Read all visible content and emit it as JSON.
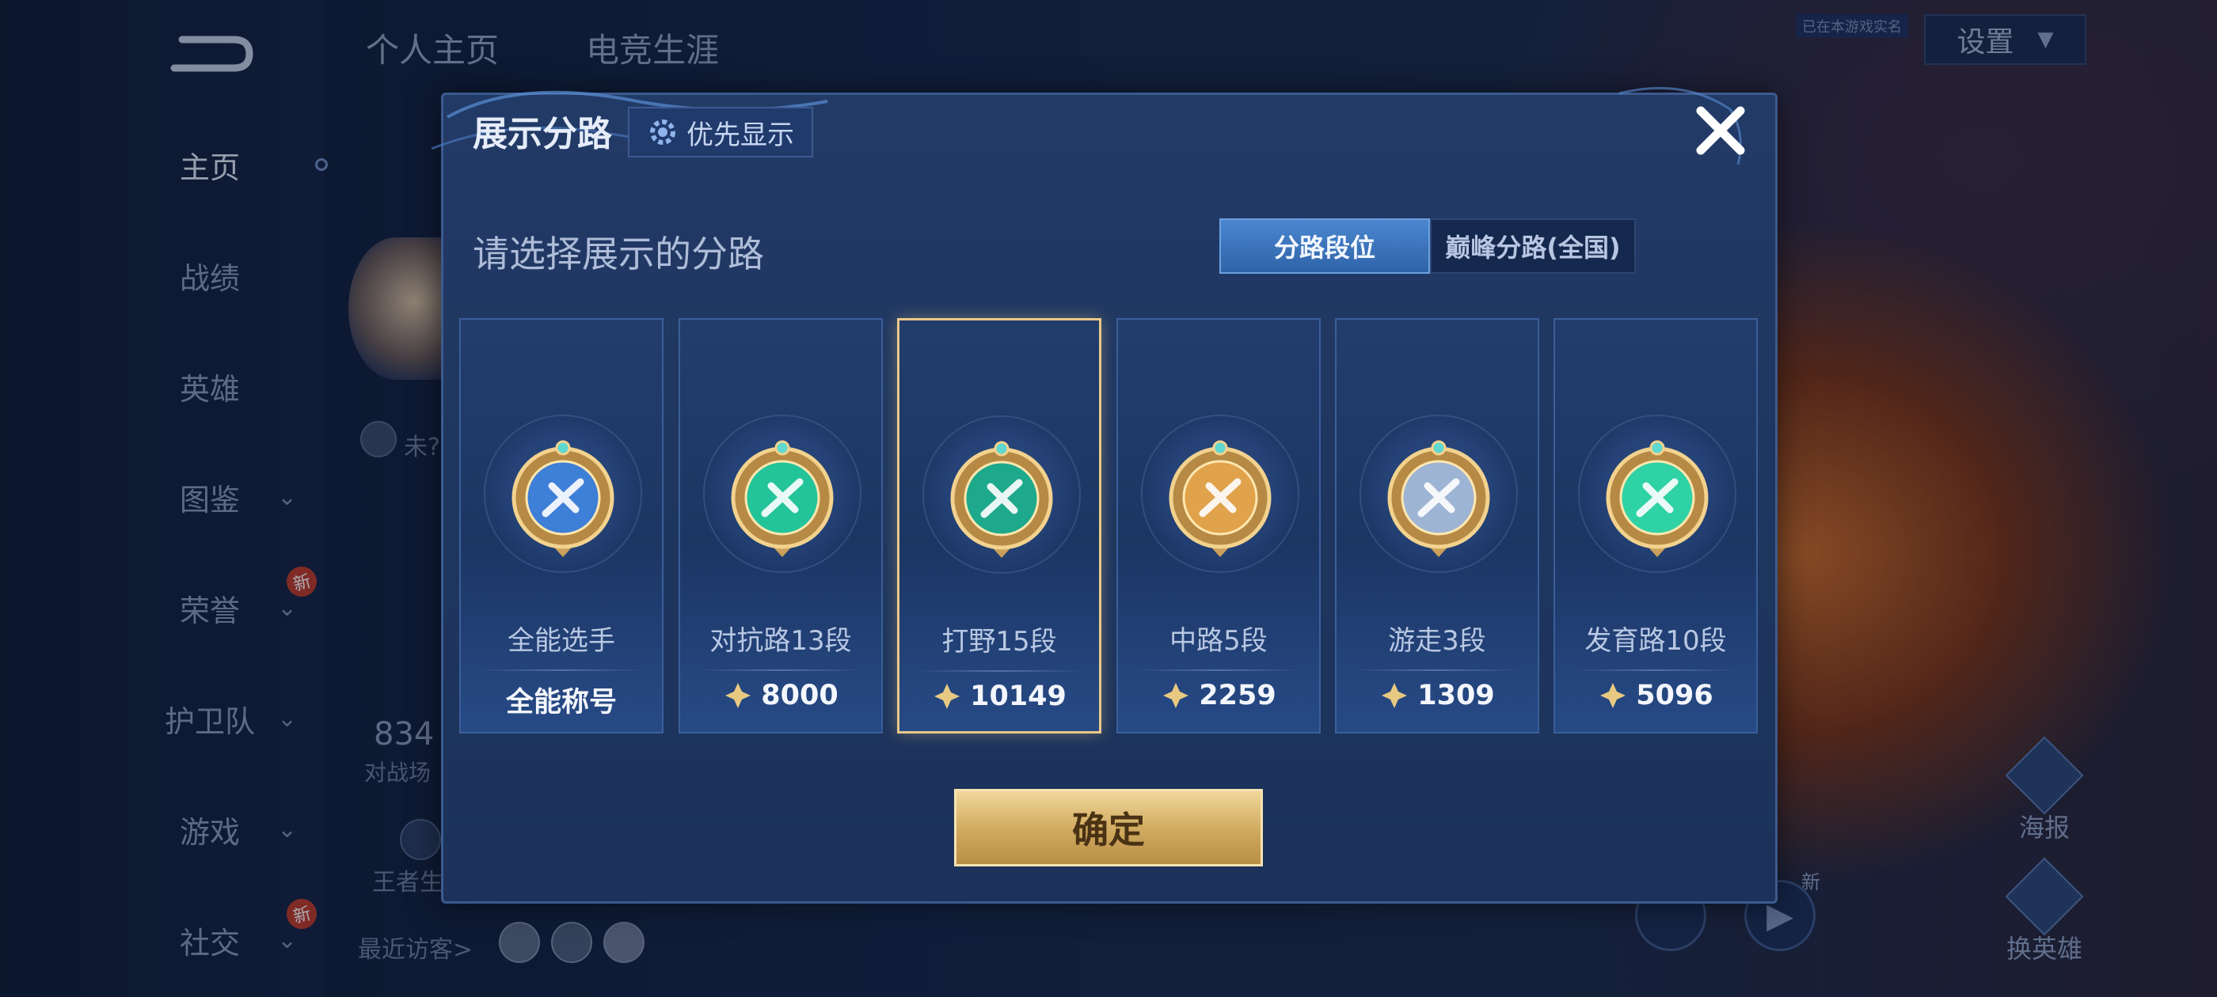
{
  "background": {
    "top_tabs": [
      "个人主页",
      "电竞生涯"
    ],
    "nav_items": [
      {
        "label": "主页",
        "chevron": false,
        "is_new": false,
        "active": true
      },
      {
        "label": "战绩",
        "chevron": false,
        "is_new": false,
        "active": false
      },
      {
        "label": "英雄",
        "chevron": false,
        "is_new": false,
        "active": false
      },
      {
        "label": "图鉴",
        "chevron": true,
        "is_new": false,
        "active": false
      },
      {
        "label": "荣誉",
        "chevron": true,
        "is_new": true,
        "active": false
      },
      {
        "label": "护卫队",
        "chevron": true,
        "is_new": false,
        "active": false
      },
      {
        "label": "游戏",
        "chevron": true,
        "is_new": false,
        "active": false
      },
      {
        "label": "社交",
        "chevron": true,
        "is_new": true,
        "active": false
      }
    ],
    "new_tag": "新",
    "settings_label": "设置",
    "small_tag": "已在本游戏实名",
    "profile_status": "未?",
    "battle_count": "834",
    "battle_label": "对战场",
    "king_label": "王者生",
    "recent_visitors": "最近访客>",
    "poster_label": "海报",
    "change_hero_label": "换英雄"
  },
  "modal": {
    "title": "展示分路",
    "priority_label": "优先显示",
    "subtitle": "请选择展示的分路",
    "segment_tabs": [
      {
        "label": "分路段位",
        "active": true
      },
      {
        "label": "巅峰分路(全国)",
        "active": false
      }
    ],
    "cards": [
      {
        "name": "全能选手",
        "value": "全能称号",
        "show_icon": false,
        "selected": false,
        "emblem": "all-round-emblem-icon",
        "color": "#3e7fd8"
      },
      {
        "name": "对抗路13段",
        "value": "8000",
        "show_icon": true,
        "selected": false,
        "emblem": "clash-lane-emblem-icon",
        "color": "#23c49a"
      },
      {
        "name": "打野15段",
        "value": "10149",
        "show_icon": true,
        "selected": true,
        "emblem": "jungle-emblem-icon",
        "color": "#1ea98c"
      },
      {
        "name": "中路5段",
        "value": "2259",
        "show_icon": true,
        "selected": false,
        "emblem": "mid-lane-emblem-icon",
        "color": "#e0a24a"
      },
      {
        "name": "游走3段",
        "value": "1309",
        "show_icon": true,
        "selected": false,
        "emblem": "roam-emblem-icon",
        "color": "#9eb4d4"
      },
      {
        "name": "发育路10段",
        "value": "5096",
        "show_icon": true,
        "selected": false,
        "emblem": "farm-lane-emblem-icon",
        "color": "#2fd2a4"
      }
    ],
    "confirm_label": "确定"
  }
}
